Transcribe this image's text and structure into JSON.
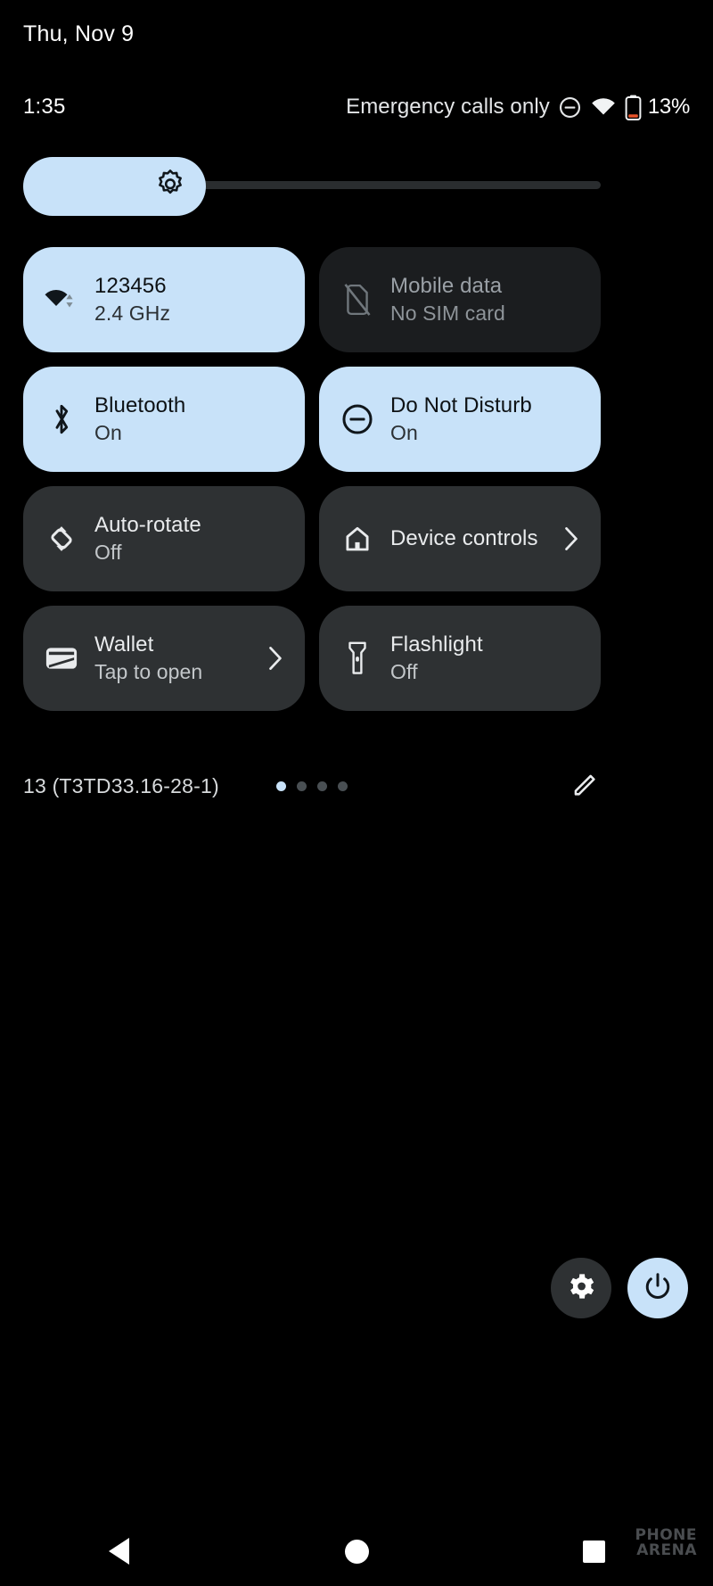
{
  "header": {
    "date": "Thu, Nov 9"
  },
  "status_bar": {
    "clock": "1:35",
    "carrier": "Emergency calls only",
    "dnd_icon": "do-not-disturb-icon",
    "wifi_icon": "wifi-icon",
    "battery_icon": "battery-low-icon",
    "battery_percent": "13%"
  },
  "brightness": {
    "icon": "brightness-icon",
    "level_percent": 31
  },
  "tiles": [
    {
      "id": "wifi",
      "icon": "wifi-tile-icon",
      "title": "123456",
      "subtitle": "2.4 GHz",
      "state": "active",
      "chevron": false
    },
    {
      "id": "mobile-data",
      "icon": "sim-off-icon",
      "title": "Mobile data",
      "subtitle": "No SIM card",
      "state": "disabled",
      "chevron": false
    },
    {
      "id": "bluetooth",
      "icon": "bluetooth-icon",
      "title": "Bluetooth",
      "subtitle": "On",
      "state": "active",
      "chevron": false
    },
    {
      "id": "do-not-disturb",
      "icon": "do-not-disturb-icon",
      "title": "Do Not Disturb",
      "subtitle": "On",
      "state": "active",
      "chevron": false
    },
    {
      "id": "auto-rotate",
      "icon": "auto-rotate-icon",
      "title": "Auto-rotate",
      "subtitle": "Off",
      "state": "inactive",
      "chevron": false
    },
    {
      "id": "device-controls",
      "icon": "home-icon",
      "title": "Device controls",
      "subtitle": "",
      "state": "inactive",
      "chevron": true
    },
    {
      "id": "wallet",
      "icon": "wallet-icon",
      "title": "Wallet",
      "subtitle": "Tap to open",
      "state": "inactive",
      "chevron": true
    },
    {
      "id": "flashlight",
      "icon": "flashlight-icon",
      "title": "Flashlight",
      "subtitle": "Off",
      "state": "inactive",
      "chevron": false
    }
  ],
  "footer": {
    "build": "13 (T3TD33.16-28-1)",
    "pages": 4,
    "active_page": 1,
    "edit_icon": "pencil-icon"
  },
  "bottom_actions": {
    "settings_icon": "gear-icon",
    "power_icon": "power-icon"
  },
  "nav_bar": {
    "back_icon": "back-triangle-icon",
    "home_icon": "home-circle-icon",
    "recents_icon": "recents-square-icon"
  },
  "watermark": {
    "line1": "PHONE",
    "line2": "ARENA"
  },
  "colors": {
    "background": "#000000",
    "accent": "#c8e2f9",
    "tile_inactive": "#2e3133",
    "tile_disabled": "#1b1d1f",
    "battery_low": "#e8542a"
  }
}
